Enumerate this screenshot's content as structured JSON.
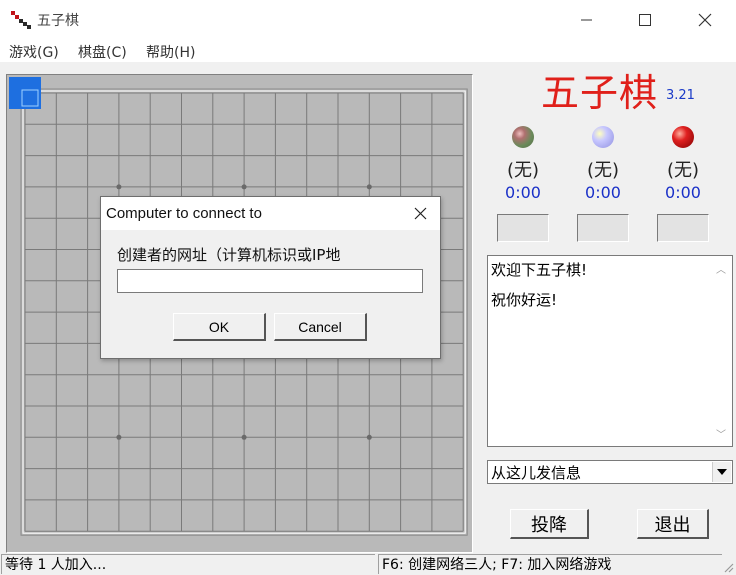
{
  "window": {
    "title": "五子棋"
  },
  "menu": [
    {
      "label": "游戏(G)"
    },
    {
      "label": "棋盘(C)"
    },
    {
      "label": "帮助(H)"
    }
  ],
  "brand": {
    "title": "五子棋",
    "version": "3.21",
    "color": "#e0201a"
  },
  "players": [
    {
      "name": "(无)",
      "time": "0:00",
      "stone_color": "gray-green"
    },
    {
      "name": "(无)",
      "time": "0:00",
      "stone_color": "lavender"
    },
    {
      "name": "(无)",
      "time": "0:00",
      "stone_color": "red"
    }
  ],
  "chat": {
    "messages": [
      "欢迎下五子棋!",
      "祝你好运!"
    ],
    "input_value": "从这儿发信息"
  },
  "buttons": {
    "resign": "投降",
    "exit": "退出"
  },
  "status": {
    "left": "等待 1 人加入...",
    "right": "F6: 创建网络三人; F7: 加入网络游戏"
  },
  "dialog": {
    "title": "Computer to connect to",
    "label": "创建者的网址（计算机标识或IP地",
    "input_value": "",
    "ok": "OK",
    "cancel": "Cancel"
  },
  "board": {
    "size": 15,
    "highlight_cell": "top-left",
    "background": "#b9b9b9"
  }
}
